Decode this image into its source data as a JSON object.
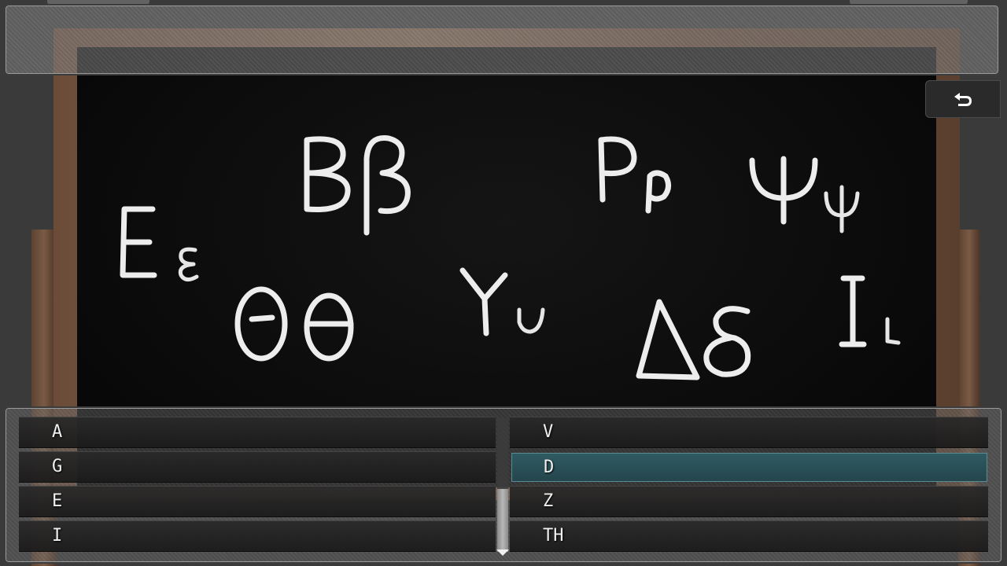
{
  "chalkboard": {
    "letters": [
      {
        "upper": "Β",
        "lower": "β"
      },
      {
        "upper": "Ε",
        "lower": "ε"
      },
      {
        "upper": "Θ",
        "lower": "θ"
      },
      {
        "upper": "Υ",
        "lower": "υ"
      },
      {
        "upper": "Ρ",
        "lower": "ρ"
      },
      {
        "upper": "Ψ",
        "lower": "ψ"
      },
      {
        "upper": "Δ",
        "lower": "δ"
      },
      {
        "upper": "Ι",
        "lower": "ι"
      }
    ]
  },
  "back_button": {
    "icon": "return-arrow-icon"
  },
  "choices": {
    "left": [
      "A",
      "G",
      "E",
      "I"
    ],
    "right": [
      "V",
      "D",
      "Z",
      "TH"
    ],
    "selected": "D"
  },
  "colors": {
    "selected_highlight": "#2f5a62",
    "chalk": "#ededed",
    "board": "#0a0a0a"
  }
}
